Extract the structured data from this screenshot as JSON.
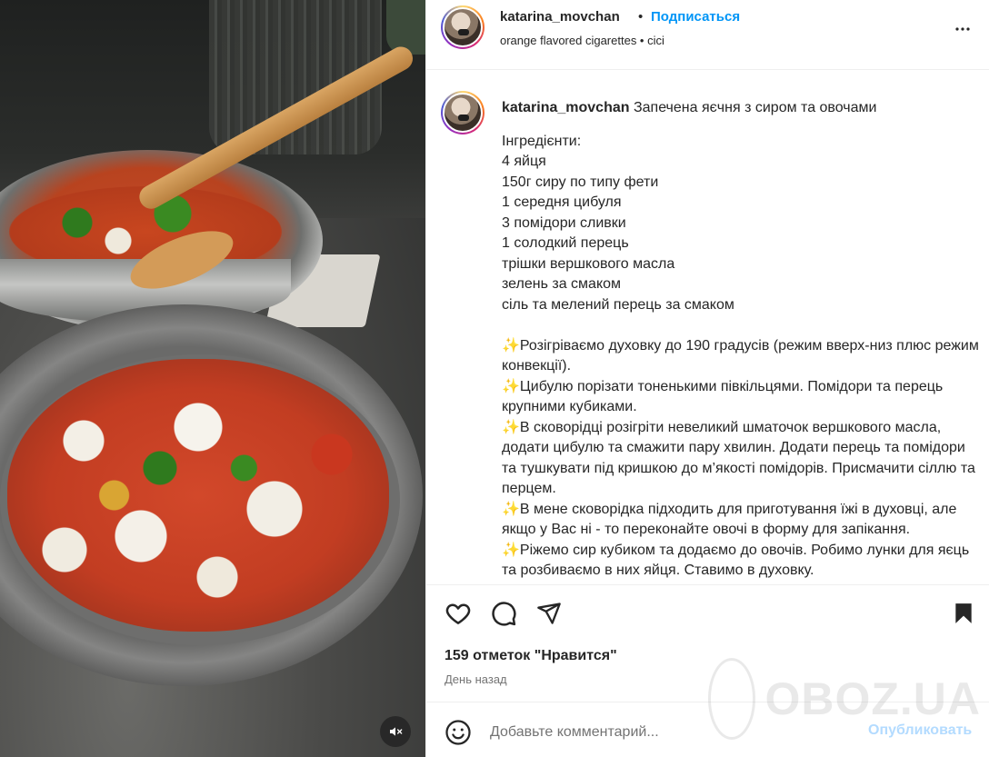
{
  "post": {
    "author": "katarina_movchan",
    "dot": "•",
    "follow_label": "Подписаться",
    "subtitle": "orange flavored cigarettes • cici"
  },
  "caption": {
    "username": "katarina_movchan",
    "title": " Запечена яєчня з сиром та овочами",
    "body": "Інгредієнти:\n4 яйця\n150г сиру по типу фети\n1 середня цибуля\n3 помідори сливки\n1 солодкий перець\nтрішки вершкового масла\nзелень за смаком\nсіль та мелений перець за смаком\n\n✨Розігріваємо духовку до 190 градусів (режим вверх-низ плюс режим конвекції).\n✨Цибулю порізати тоненькими півкільцями. Помідори та перець крупними кубиками.\n✨В сковорідці розігріти невеликий шматочок вершкового масла, додати цибулю та смажити пару хвилин. Додати перець та помідори та тушкувати під кришкою до м’якості помідорів. Присмачити сіллю та перцем.\n✨В мене сковорідка підходить для приготування їжі в духовці, але якщо у Вас ні - то переконайте овочі в форму для запікання.\n✨Ріжемо сир кубиком та додаємо до овочів. Робимо лунки для яєць та розбиваємо в них яйця. Ставимо в духовку."
  },
  "stats": {
    "likes": "159 отметок \"Нравится\"",
    "date": "День назад"
  },
  "comment": {
    "placeholder": "Добавьте комментарий...",
    "publish_label": "Опубликовать"
  },
  "watermark": {
    "text": "OBOZ.UA"
  },
  "icons": {
    "like": "heart-icon",
    "comment": "comment-icon",
    "share": "send-icon",
    "save": "bookmark-icon",
    "more": "more-icon",
    "emoji": "emoji-icon",
    "mute": "sound-off-icon"
  },
  "colors": {
    "link": "#0095f6",
    "publish_disabled": "#b3dbff",
    "muted_text": "#737373",
    "text": "#262626"
  }
}
